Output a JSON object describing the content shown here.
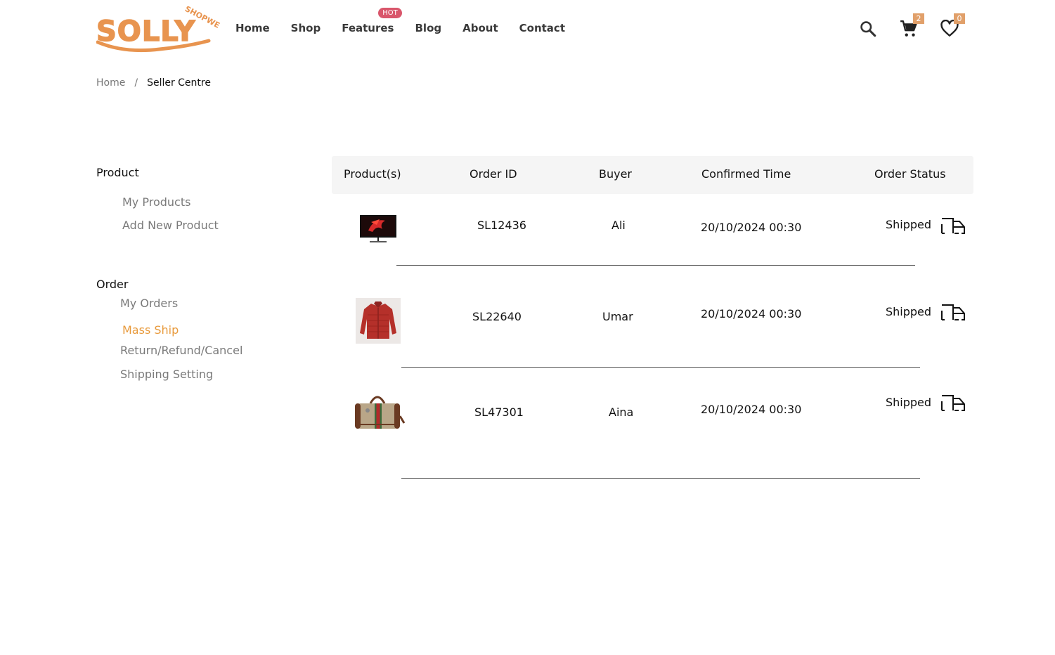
{
  "brand": {
    "name": "SOLLY",
    "tag": "SHOPWE",
    "color": "#e8944f"
  },
  "nav": {
    "items": [
      {
        "label": "Home"
      },
      {
        "label": "Shop"
      },
      {
        "label": "Features",
        "badge": "HOT"
      },
      {
        "label": "Blog"
      },
      {
        "label": "About"
      },
      {
        "label": "Contact"
      }
    ]
  },
  "header": {
    "icons": [
      "search-icon",
      "cart-icon",
      "heart-icon"
    ],
    "cart_count": "2",
    "wishlist_count": "0",
    "badge_color": "#e1a06a"
  },
  "breadcrumb": {
    "home": "Home",
    "separator": "/",
    "current": "Seller Centre"
  },
  "sidebar": {
    "product_heading": "Product",
    "product_links": [
      "My Products",
      "Add New Product"
    ],
    "order_heading": "Order",
    "order_links": [
      "My Orders",
      "Mass Ship",
      "Return/Refund/Cancel",
      "Shipping Setting"
    ],
    "active": "Mass Ship",
    "active_color": "#e89a3c"
  },
  "table": {
    "columns": [
      "Product(s)",
      "Order ID",
      "Buyer",
      "Confirmed Time",
      "Order Status"
    ],
    "rows": [
      {
        "product_image": "monitor",
        "order_id": "SL12436",
        "buyer": "Ali",
        "confirmed_time": "20/10/2024 00:30",
        "status": "Shipped"
      },
      {
        "product_image": "red-jacket",
        "order_id": "SL22640",
        "buyer": "Umar",
        "confirmed_time": "20/10/2024 00:30",
        "status": "Shipped"
      },
      {
        "product_image": "duffel-bag",
        "order_id": "SL47301",
        "buyer": "Aina",
        "confirmed_time": "20/10/2024 00:30",
        "status": "Shipped"
      }
    ]
  }
}
